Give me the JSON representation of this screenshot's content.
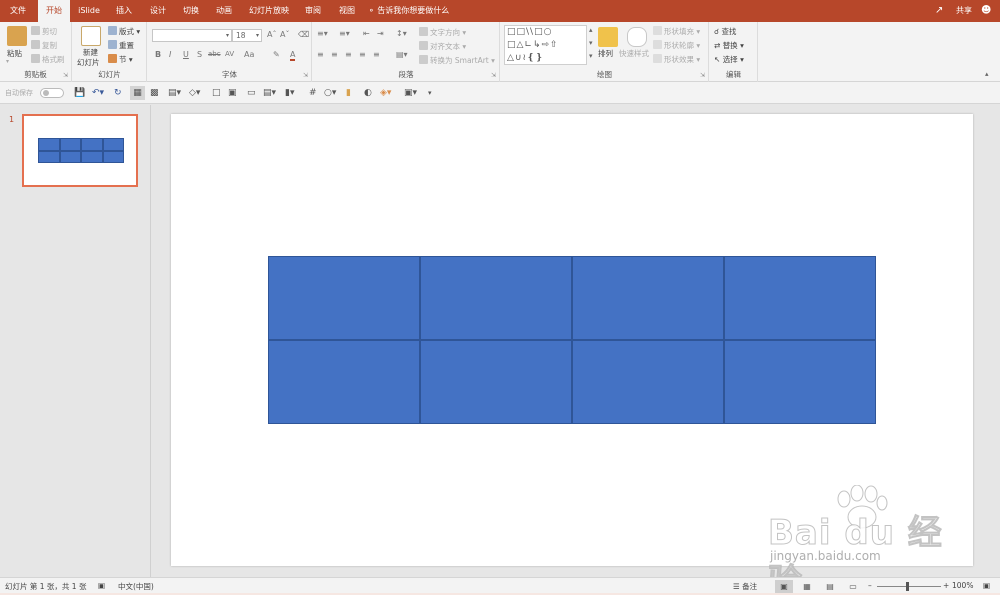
{
  "tabs": [
    "文件",
    "开始",
    "iSlide",
    "插入",
    "设计",
    "切换",
    "动画",
    "幻灯片放映",
    "审阅",
    "视图"
  ],
  "active_tab": "开始",
  "tell_me": "告诉我你想要做什么",
  "share": "共享",
  "ribbon": {
    "clipboard": {
      "label": "剪贴板",
      "paste": "粘贴",
      "cut": "剪切",
      "copy": "复制",
      "format_painter": "格式刷"
    },
    "slides": {
      "label": "幻灯片",
      "new_slide_1": "新建",
      "new_slide_2": "幻灯片",
      "layout": "版式",
      "reset": "重置",
      "section": "节"
    },
    "font": {
      "label": "字体",
      "font_name": "",
      "font_size": "18",
      "bold": "B",
      "italic": "I",
      "underline": "U",
      "shadow": "S",
      "strike": "abc",
      "spacing": "AV",
      "case": "Aa",
      "color": "A"
    },
    "paragraph": {
      "label": "段落",
      "text_direction": "文字方向",
      "align_text": "对齐文本",
      "smartart": "转换为 SmartArt"
    },
    "drawing": {
      "label": "绘图",
      "arrange": "排列",
      "quick_styles": "快速样式",
      "shape_fill": "形状填充",
      "shape_outline": "形状轮廓",
      "shape_effects": "形状效果"
    },
    "editing": {
      "label": "编辑",
      "find": "查找",
      "replace": "替换",
      "select": "选择"
    }
  },
  "qat": {
    "autosave": "自动保存"
  },
  "thumbnail": {
    "number": "1"
  },
  "table": {
    "rows": 2,
    "cols": 4,
    "fill": "#4472c4",
    "border": "#2f5597"
  },
  "status": {
    "slide_info": "幻灯片 第 1 张，共 1 张",
    "language": "中文(中国)",
    "notes": "备注",
    "zoom": "100%"
  },
  "watermark": {
    "main": "Bai du 经验",
    "sub": "jingyan.baidu.com"
  },
  "colors": {
    "accent": "#b7472a",
    "table_fill": "#4472c4",
    "selection": "#e4704f"
  }
}
